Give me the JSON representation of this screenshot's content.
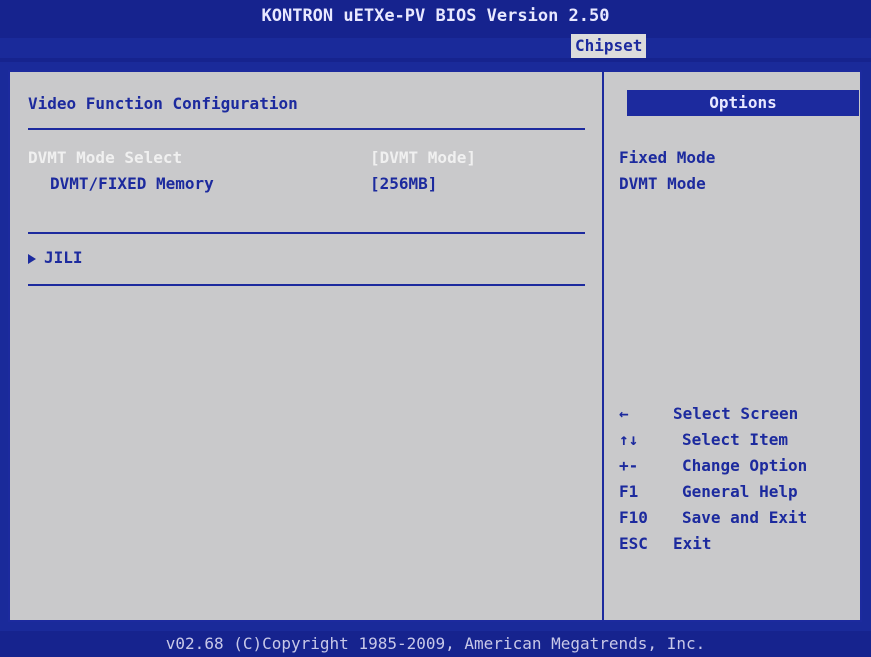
{
  "header": {
    "title": "KONTRON uETXe-PV BIOS Version 2.50",
    "active_tab": "Chipset"
  },
  "left_panel": {
    "section_title": "Video Function Configuration",
    "settings": [
      {
        "label": "DVMT Mode Select",
        "value": "[DVMT Mode]"
      },
      {
        "label": "DVMT/FIXED Memory",
        "value": "[256MB]"
      }
    ],
    "submenu": "JILI"
  },
  "right_panel": {
    "options_header": "Options",
    "options": [
      "Fixed Mode",
      "DVMT Mode"
    ],
    "help": [
      {
        "key": "←",
        "text": "Select Screen"
      },
      {
        "key": "↑↓",
        "text": "Select Item"
      },
      {
        "key": "+-",
        "text": "Change Option"
      },
      {
        "key": "F1",
        "text": "General Help"
      },
      {
        "key": "F10",
        "text": "Save and Exit"
      },
      {
        "key": "ESC",
        "text": "Exit"
      }
    ]
  },
  "footer": {
    "text": "v02.68 (C)Copyright 1985-2009, American Megatrends, Inc."
  },
  "colors": {
    "background": "#1a2a9a",
    "panel": "#c9c9cb",
    "accent": "#1c2a9e",
    "text_light": "#f0f0f0"
  }
}
